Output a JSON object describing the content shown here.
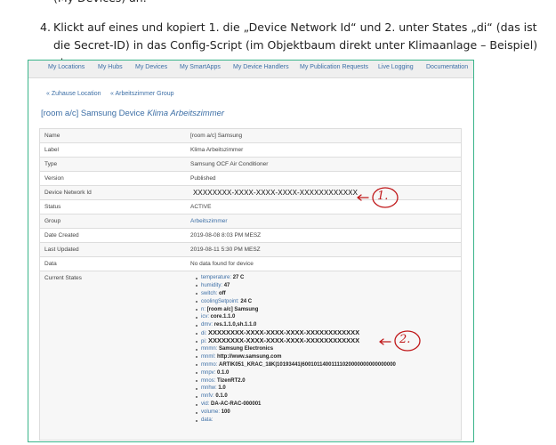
{
  "article": {
    "cut_line": "(My Devices) an.",
    "step_number": "4.",
    "step_text": "Klickt auf eines und kopiert 1. die „Device Network Id“ und 2. unter States „di“ (das ist die Secret-ID) in das Config-Script (im Objektbaum direkt unter Klimaanlage – Beispiel) ein:"
  },
  "nav": {
    "items": [
      "My Locations",
      "My Hubs",
      "My Devices",
      "My SmartApps",
      "My Device Handlers",
      "My Publication Requests",
      "Live Logging",
      "Documentation"
    ]
  },
  "breadcrumb": {
    "items": [
      "« Zuhause Location",
      "« Arbeitszimmer Group"
    ]
  },
  "page_title": {
    "prefix": "[room a/c] Samsung Device",
    "name": "Klima Arbeitszimmer"
  },
  "details": {
    "rows": [
      {
        "label": "Name",
        "value": "[room a/c] Samsung"
      },
      {
        "label": "Label",
        "value": "Klima Arbeitszimmer"
      },
      {
        "label": "Type",
        "value": "Samsung OCF Air Conditioner"
      },
      {
        "label": "Version",
        "value": "Published"
      },
      {
        "label": "Device Network Id",
        "value": "XXXXXXXX-XXXX-XXXX-XXXX-XXXXXXXXXXXX"
      },
      {
        "label": "Status",
        "value": "ACTIVE"
      },
      {
        "label": "Group",
        "value": "Arbeitszimmer"
      },
      {
        "label": "Date Created",
        "value": "2019-08-08 8:03 PM MESZ"
      },
      {
        "label": "Last Updated",
        "value": "2019-08-11 5:30 PM MESZ"
      },
      {
        "label": "Data",
        "value": "No data found for device"
      },
      {
        "label": "Current States",
        "value": ""
      }
    ]
  },
  "states": [
    {
      "key": "temperature:",
      "value": "27 C"
    },
    {
      "key": "humidity:",
      "value": "47"
    },
    {
      "key": "switch:",
      "value": "off"
    },
    {
      "key": "coolingSetpoint:",
      "value": "24 C"
    },
    {
      "key": "n:",
      "value": "[room a/c] Samsung"
    },
    {
      "key": "icv:",
      "value": "core.1.1.0"
    },
    {
      "key": "dmv:",
      "value": "res.1.1.0,sh.1.1.0"
    },
    {
      "key": "di:",
      "value": "XXXXXXXX-XXXX-XXXX-XXXX-XXXXXXXXXXXX"
    },
    {
      "key": "pi:",
      "value": "XXXXXXXX-XXXX-XXXX-XXXX-XXXXXXXXXXXX"
    },
    {
      "key": "mnmn:",
      "value": "Samsung Electronics"
    },
    {
      "key": "mnml:",
      "value": "http://www.samsung.com"
    },
    {
      "key": "mnmo:",
      "value": "ARTIK051_KRAC_18K|10193441|60010114001111020000000000000000"
    },
    {
      "key": "mnpv:",
      "value": "0.1.0"
    },
    {
      "key": "mnos:",
      "value": "TizenRT2.0"
    },
    {
      "key": "mnhw:",
      "value": "1.0"
    },
    {
      "key": "mnfv:",
      "value": "0.1.0"
    },
    {
      "key": "vid:",
      "value": "DA-AC-RAC-000001"
    },
    {
      "key": "volume:",
      "value": "100"
    },
    {
      "key": "data:",
      "value": ""
    }
  ],
  "annotations": {
    "one": "1.",
    "two": "2."
  },
  "colors": {
    "link": "#3d6fa6",
    "frame": "#39b48a",
    "annotation": "#c0181a"
  }
}
